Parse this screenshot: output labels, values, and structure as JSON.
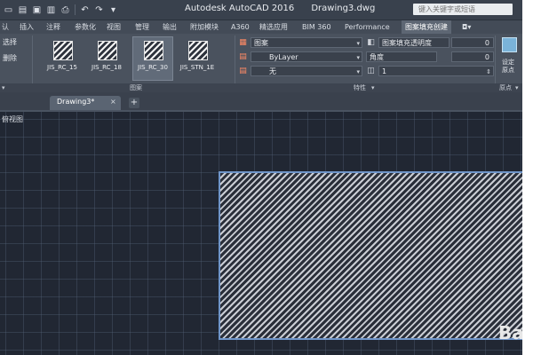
{
  "title_bar": {
    "app_title": "Autodesk AutoCAD 2016      Drawing3.dwg",
    "search_placeholder": "键入关键字或短语"
  },
  "ribbon_tabs": [
    "认",
    "插入",
    "注释",
    "参数化",
    "视图",
    "管理",
    "输出",
    "附加模块",
    "A360",
    "精选应用",
    "BIM 360",
    "Performance",
    "图案填充创建"
  ],
  "ribbon": {
    "left_buttons": [
      "选择",
      "删除"
    ],
    "patterns": [
      "JIS_RC_15",
      "JIS_RC_18",
      "JIS_RC_30",
      "JIS_STN_1E"
    ],
    "selected_pattern": "JIS_RC_30",
    "panel_pattern_label": "图案",
    "properties": {
      "type": "图案",
      "color": "ByLayer",
      "background": "无",
      "transparency_label": "图案填充透明度",
      "transparency_value": "0",
      "angle_label": "角度",
      "angle_value": "0",
      "scale_value": "1"
    },
    "panel_properties_label": "特性",
    "origin_button": "设定\n原点",
    "panel_origin_label": "原点"
  },
  "doc_tabs": {
    "active": "Drawing3*",
    "close": "×",
    "add": "+"
  },
  "viewport_label": "俯视图",
  "watermark": "Ba",
  "colors": {
    "hatch_border": "#6f95c9",
    "ribbon": "#4a525e",
    "canvas": "#212733"
  }
}
